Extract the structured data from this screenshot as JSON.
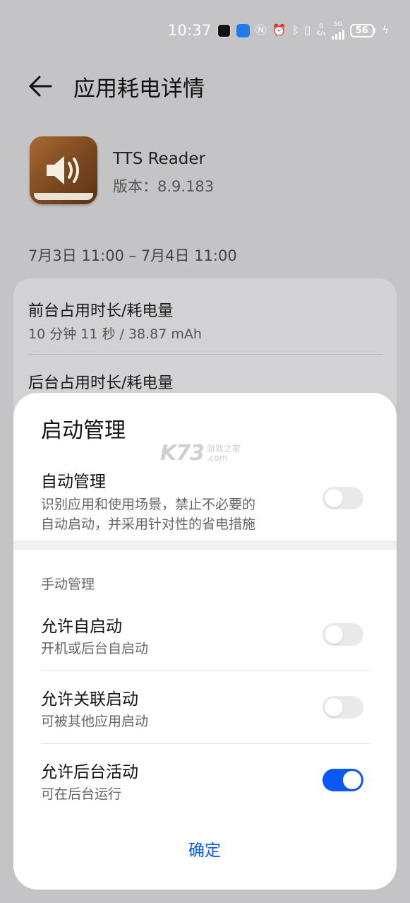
{
  "status_bar": {
    "time": "10:37",
    "network_speed_value": "0",
    "network_speed_unit": "K/s",
    "network_type": "5G",
    "battery_level": "56",
    "icons": [
      "tiktok-icon",
      "app-notification-icon",
      "nfc-icon",
      "alarm-icon",
      "bluetooth-icon",
      "vibrate-icon",
      "signal-icon",
      "battery-icon",
      "charging-icon"
    ]
  },
  "header": {
    "title": "应用耗电详情"
  },
  "app": {
    "name": "TTS Reader",
    "version": "版本：8.9.183"
  },
  "date_range": "7月3日 11:00 – 7月4日 11:00",
  "stats": {
    "foreground_title": "前台占用时长/耗电量",
    "foreground_value": "10 分钟 11 秒 / 38.87 mAh",
    "background_title": "后台占用时长/耗电量"
  },
  "sheet": {
    "title": "启动管理",
    "watermark_main": "K73",
    "watermark_site": "游戏之家",
    "watermark_domain": ".com",
    "auto": {
      "title": "自动管理",
      "desc_line1": "识别应用和使用场景，禁止不必要的",
      "desc_line2": "自动启动，并采用针对性的省电措施",
      "enabled": false
    },
    "manual_label": "手动管理",
    "items": [
      {
        "title": "允许自启动",
        "desc": "开机或后台自启动",
        "enabled": false
      },
      {
        "title": "允许关联启动",
        "desc": "可被其他应用启动",
        "enabled": false
      },
      {
        "title": "允许后台活动",
        "desc": "可在后台运行",
        "enabled": true
      }
    ],
    "confirm": "确定"
  },
  "colors": {
    "accent": "#0a59f7",
    "overlay_background": "#c4c4c6",
    "sheet_background": "#ffffff"
  }
}
